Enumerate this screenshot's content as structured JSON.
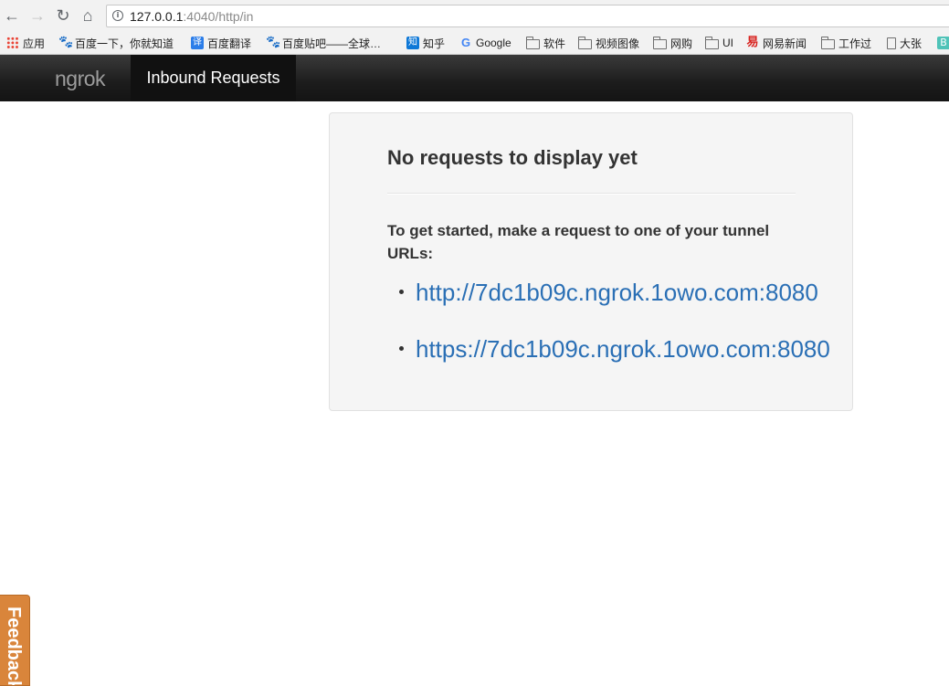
{
  "browser": {
    "url_host": "127.0.0.1",
    "url_rest": ":4040/http/in",
    "bookmarks": [
      {
        "label": "应用",
        "icon": "apps-grid-icon"
      },
      {
        "label": "百度一下，你就知道",
        "icon": "baidu-paw-icon"
      },
      {
        "label": "百度翻译",
        "icon": "baidu-translate-icon"
      },
      {
        "label": "百度贴吧——全球…",
        "icon": "baidu-paw-icon"
      },
      {
        "label": "知乎",
        "icon": "zhihu-icon"
      },
      {
        "label": "Google",
        "icon": "google-icon"
      },
      {
        "label": "软件",
        "icon": "folder-icon"
      },
      {
        "label": "视频图像",
        "icon": "folder-icon"
      },
      {
        "label": "网购",
        "icon": "folder-icon"
      },
      {
        "label": "UI",
        "icon": "folder-icon"
      },
      {
        "label": "网易新闻",
        "icon": "netease-icon"
      },
      {
        "label": "工作过",
        "icon": "folder-icon"
      },
      {
        "label": "大张",
        "icon": "page-icon"
      }
    ],
    "icon_glyphs": {
      "baidu": "🐾",
      "translate": "译",
      "zhihu": "知",
      "google": "G",
      "netease": "易",
      "teal": "B"
    }
  },
  "navbar": {
    "brand": "ngrok",
    "active_tab": "Inbound Requests"
  },
  "panel": {
    "heading": "No requests to display yet",
    "intro": "To get started, make a request to one of your tunnel URLs:",
    "tunnel_urls": [
      "http://7dc1b09c.ngrok.1owo.com:8080",
      "https://7dc1b09c.ngrok.1owo.com:8080"
    ]
  },
  "feedback": {
    "label": "Feedback"
  },
  "colors": {
    "link": "#2a6fb5",
    "navbar": "#1c1c1c",
    "feedback_tab": "#d9853b",
    "panel_bg": "#f5f5f5"
  }
}
